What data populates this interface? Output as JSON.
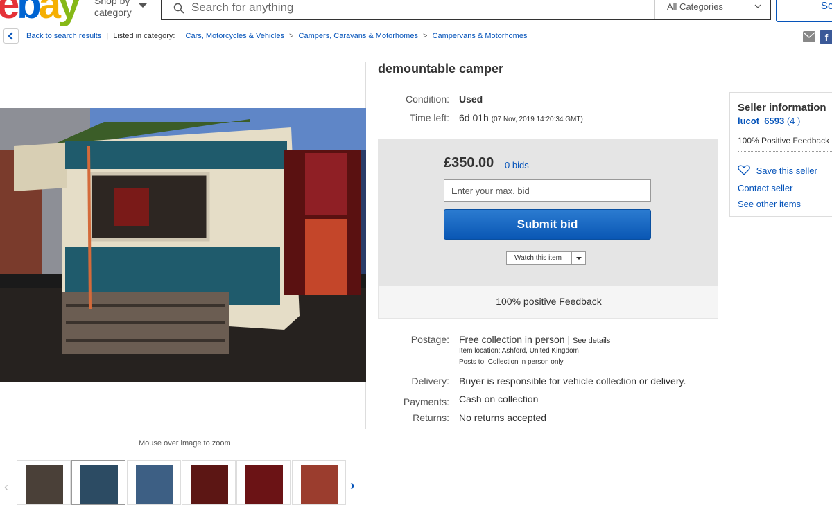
{
  "header": {
    "logo": {
      "e": "e",
      "b": "b",
      "a": "a",
      "y": "y"
    },
    "shop_by": "Shop by",
    "category": "category",
    "search_placeholder": "Search for anything",
    "category_select": "All Categories",
    "search_button": "Se"
  },
  "breadcrumb": {
    "back": "Back to search results",
    "listed_in": "Listed in category:",
    "items": [
      "Cars, Motorcycles & Vehicles",
      "Campers, Caravans & Motorhomes",
      "Campervans & Motorhomes"
    ],
    "separator": ">"
  },
  "share": {
    "facebook": "f"
  },
  "gallery": {
    "zoom_hint": "Mouse over image to zoom",
    "thumbnail_count": 6,
    "selected_index": 1
  },
  "item": {
    "title": "demountable camper",
    "condition_label": "Condition:",
    "condition": "Used",
    "time_left_label": "Time left:",
    "time_left": "6d 01h",
    "end_time": "(07 Nov, 2019   14:20:34 GMT)",
    "price": "£350.00",
    "bids": "0 bids",
    "bid_placeholder": "Enter your max. bid",
    "submit_label": "Submit bid",
    "watch_label": "Watch this item",
    "feedback": "100% positive Feedback",
    "postage_label": "Postage:",
    "postage": "Free collection in person",
    "postage_sep": "|",
    "see_details": "See details",
    "item_location_label": "Item location:",
    "item_location": "Ashford, United Kingdom",
    "posts_to_label": "Posts to:",
    "posts_to": "Collection in person only",
    "delivery_label": "Delivery:",
    "delivery": "Buyer is responsible for vehicle collection or delivery.",
    "payments_label": "Payments:",
    "payments": "Cash on collection",
    "returns_label": "Returns:",
    "returns": "No returns accepted"
  },
  "seller": {
    "heading": "Seller information",
    "name": "lucot_6593",
    "score": "(4 )",
    "feedback": "100% Positive Feedback",
    "save": "Save this seller",
    "contact": "Contact seller",
    "other": "See other items"
  },
  "colors": {
    "ebay_e": "#e53238",
    "ebay_b": "#0064d2",
    "ebay_a": "#f5af02",
    "ebay_y": "#86b817",
    "link": "#0654ba",
    "submit": "#0a57b4",
    "bid_panel": "#e5e5e5"
  },
  "icons": [
    "search-icon",
    "chevron-down-icon",
    "back-arrow-icon",
    "mail-icon",
    "facebook-icon",
    "heart-icon",
    "chevron-left-icon",
    "chevron-right-icon"
  ]
}
